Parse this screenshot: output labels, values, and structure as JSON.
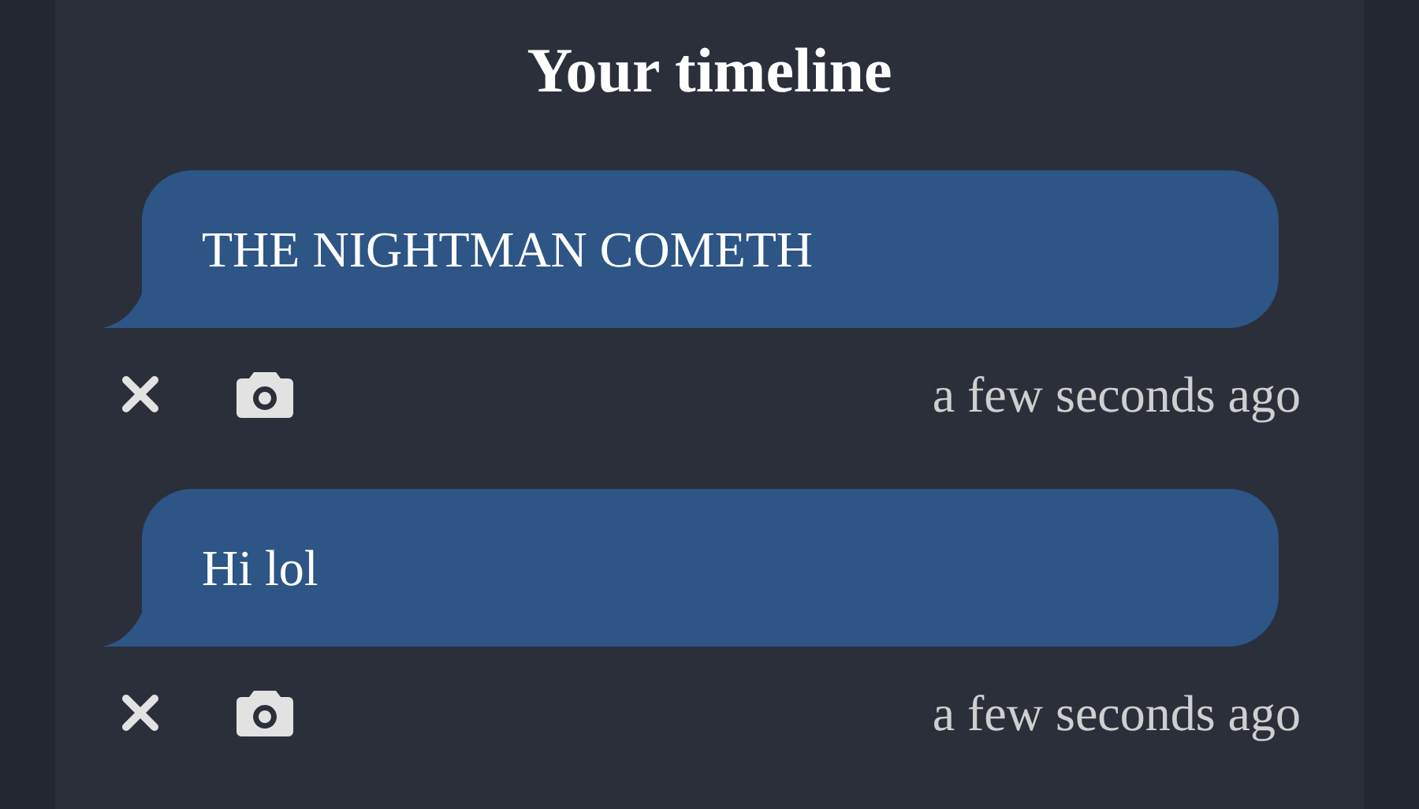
{
  "title": "Your timeline",
  "messages": [
    {
      "text": "THE NIGHTMAN COMETH",
      "time": "a few seconds ago"
    },
    {
      "text": "Hi lol",
      "time": "a few seconds ago"
    }
  ]
}
